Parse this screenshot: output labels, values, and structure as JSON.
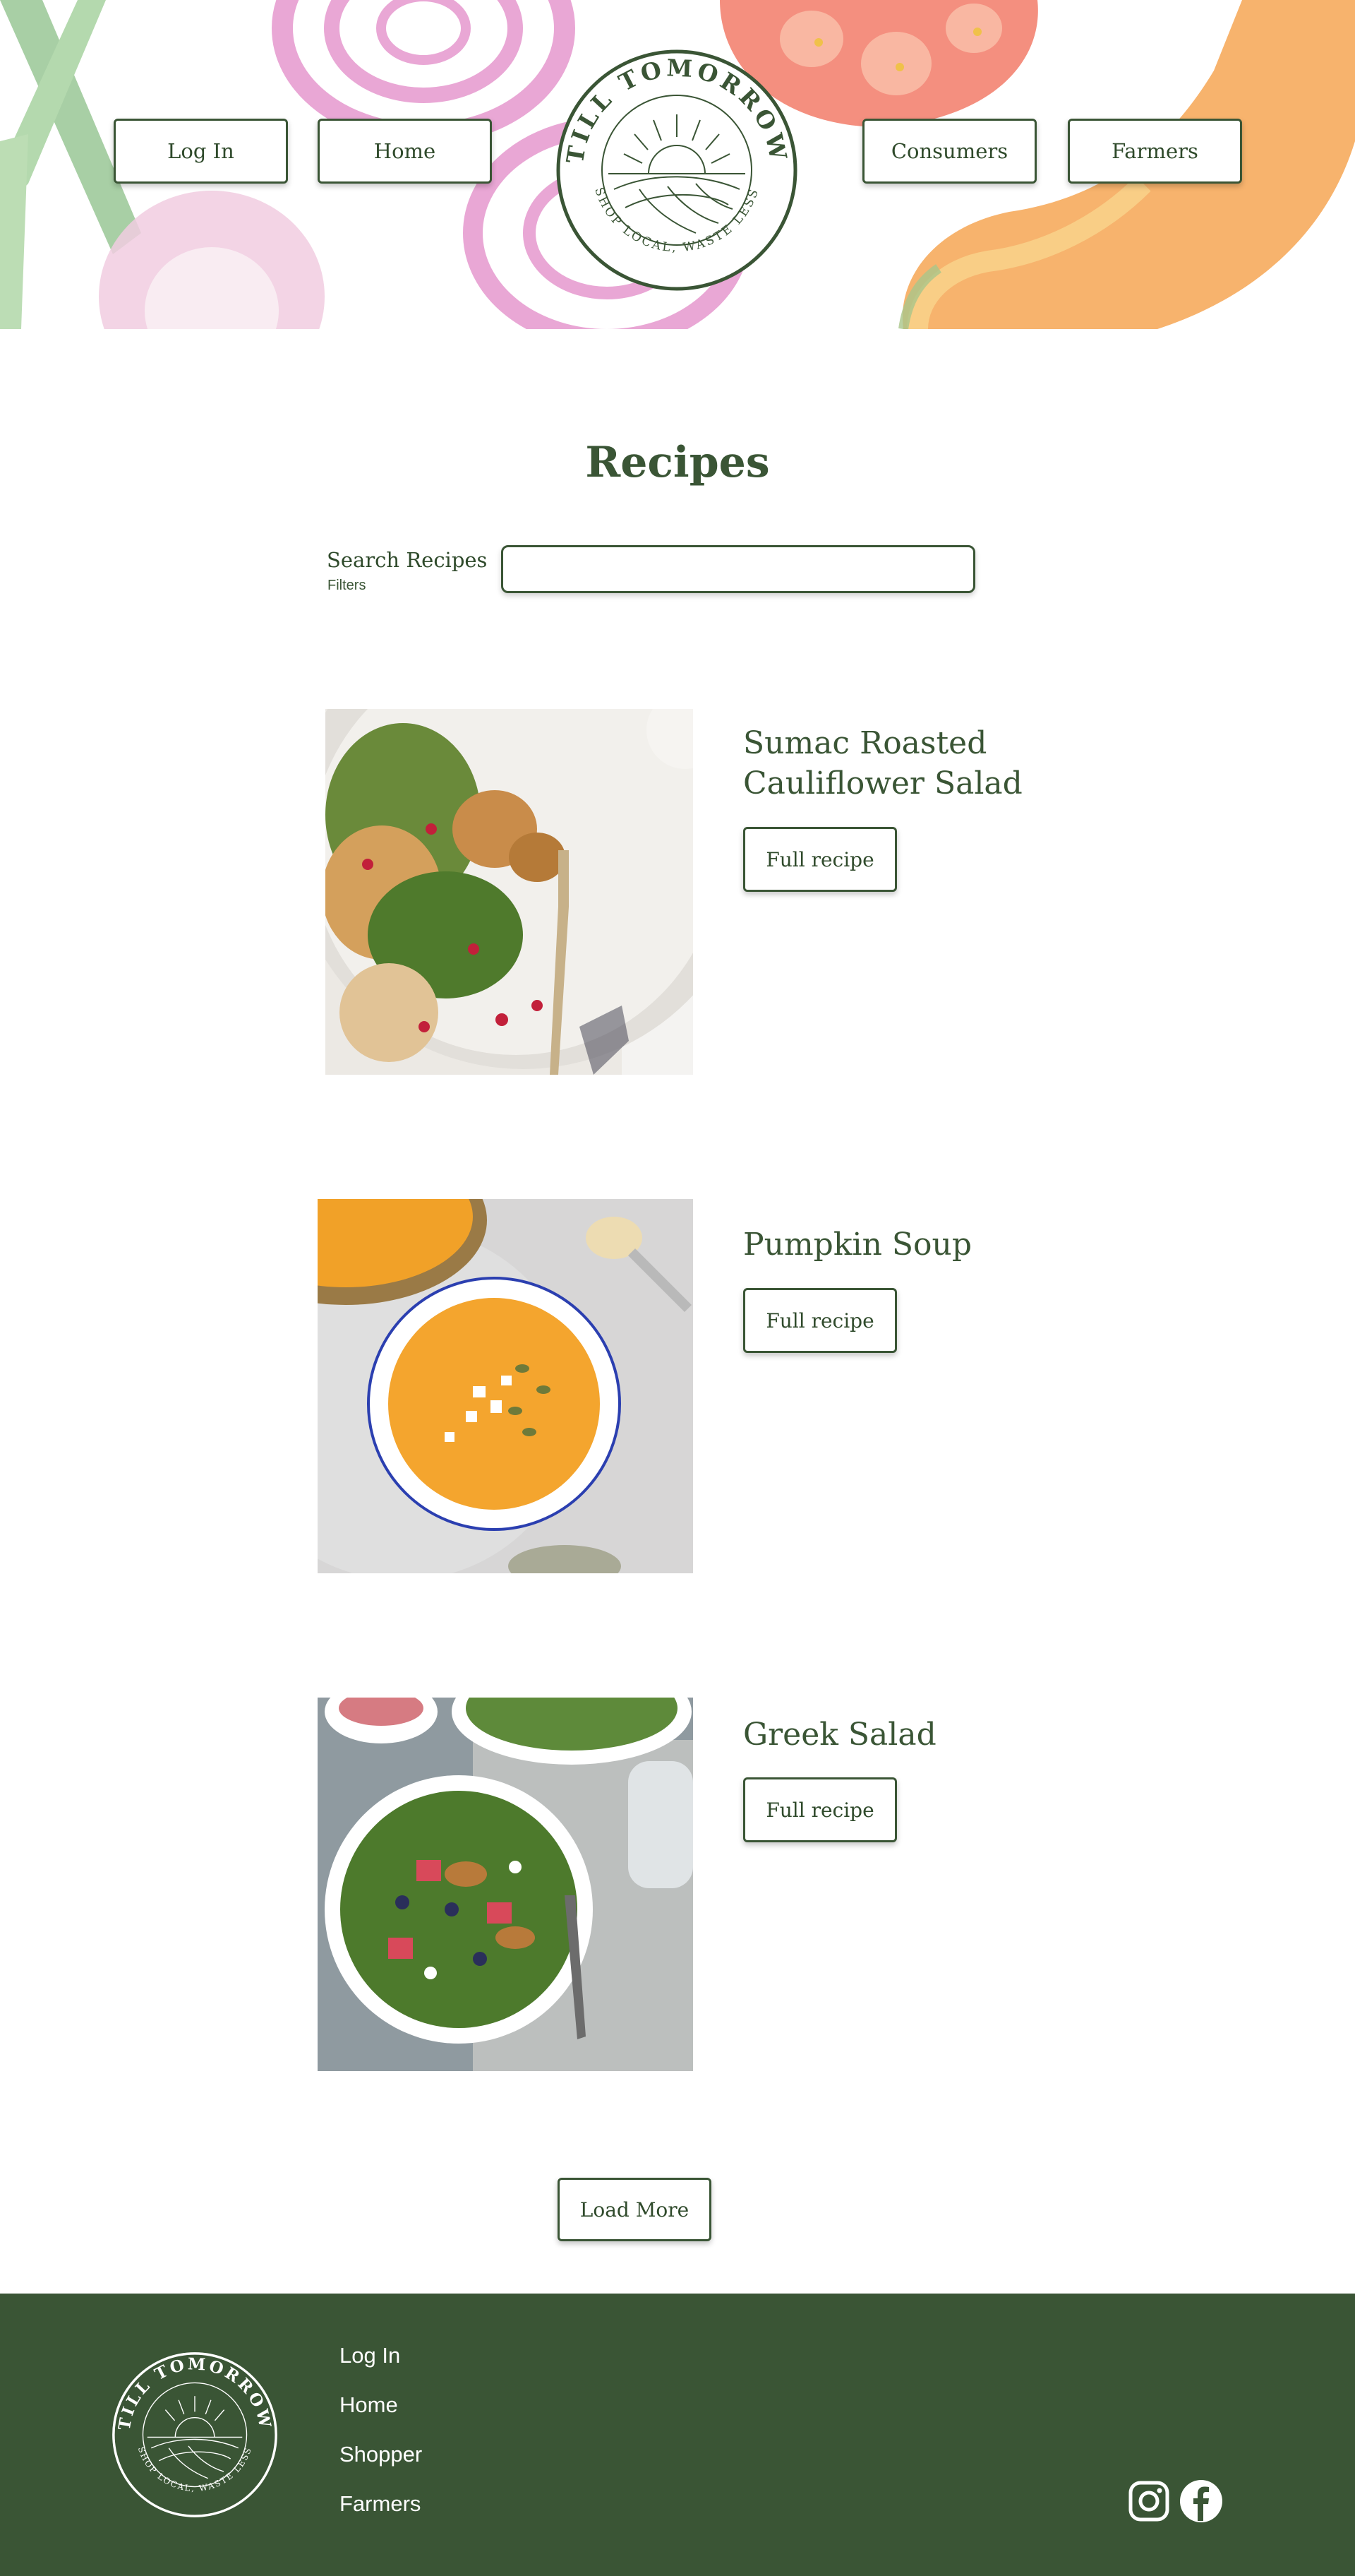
{
  "brand": {
    "logo_text_top": "TILL TOMORROW",
    "logo_text_bottom": "SHOP LOCAL, WASTE LESS"
  },
  "nav": {
    "login": "Log In",
    "home": "Home",
    "consumers": "Consumers",
    "farmers": "Farmers"
  },
  "main": {
    "title": "Recipes",
    "search_label": "Search Recipes",
    "filters_label": "Filters",
    "search_value": "",
    "search_placeholder": ""
  },
  "recipes": [
    {
      "title_line1": "Sumac Roasted",
      "title_line2": "Cauliflower Salad",
      "button": "Full recipe"
    },
    {
      "title_line1": "Pumpkin Soup",
      "title_line2": "",
      "button": "Full recipe"
    },
    {
      "title_line1": "Greek Salad",
      "title_line2": "",
      "button": "Full recipe"
    }
  ],
  "load_more": "Load More",
  "footer": {
    "links": [
      "Log In",
      "Home",
      "Shopper",
      "Farmers"
    ],
    "social": [
      "instagram-icon",
      "facebook-icon"
    ]
  },
  "colors": {
    "brand_green": "#3a5535",
    "background": "#ffffff",
    "footer_text": "#ffffff"
  }
}
